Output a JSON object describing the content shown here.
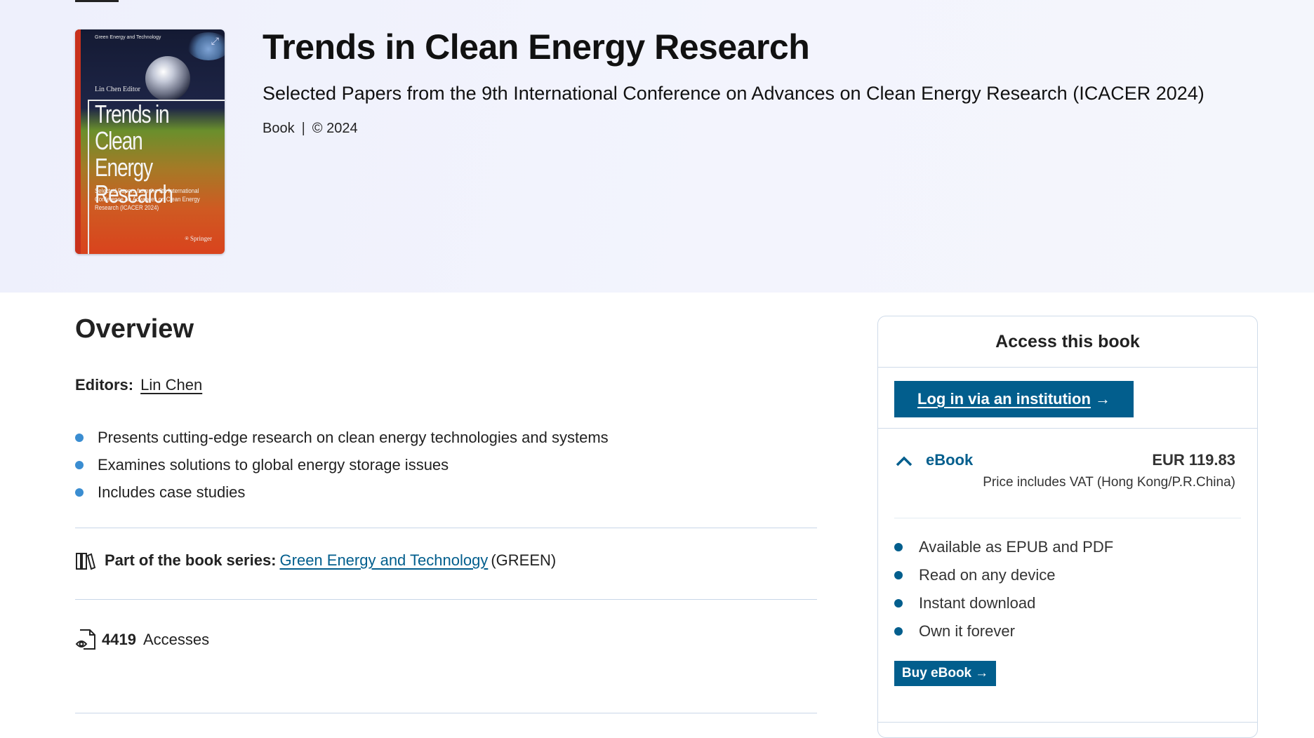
{
  "hero": {
    "title": "Trends in Clean Energy Research",
    "subtitle": "Selected Papers from the 9th International Conference on Advances on Clean Energy Research (ICACER 2024)",
    "type": "Book",
    "copyright": "© 2024"
  },
  "cover": {
    "series": "Green Energy and Technology",
    "editor": "Lin Chen  Editor",
    "title": "Trends in Clean Energy Research",
    "subtitle": "Selected Papers from the 9th International Conference on Advances on Clean Energy Research (ICACER 2024)",
    "publisher": "Springer",
    "expand_icon": "external-expand-icon"
  },
  "overview": {
    "title": "Overview",
    "editors_label": "Editors:",
    "editor_name": "Lin Chen",
    "highlights": [
      "Presents cutting-edge research on clean energy technologies and systems",
      "Examines solutions to global energy storage issues",
      "Includes case studies"
    ],
    "series_label": "Part of the book series:",
    "series_name": "Green Energy and Technology",
    "series_abbr": "(GREEN)",
    "accesses_count": "4419",
    "accesses_label": "Accesses"
  },
  "access_panel": {
    "title": "Access this book",
    "institution_button": "Log in via an institution",
    "ebook_label": "eBook",
    "ebook_price": "EUR 119.83",
    "vat_note": "Price includes VAT (Hong Kong/P.R.China)",
    "features": [
      "Available as EPUB and PDF",
      "Read on any device",
      "Instant download",
      "Own it forever"
    ],
    "buy_button": "Buy eBook"
  },
  "colors": {
    "brand_blue": "#025e8d",
    "bullet_blue": "#3a8dd1",
    "hero_bg": "#eef0fc"
  }
}
